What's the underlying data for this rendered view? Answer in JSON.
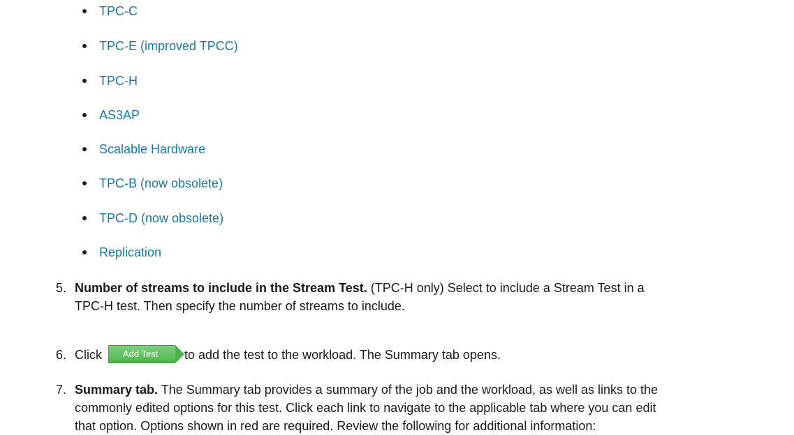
{
  "bullets": [
    "TPC-C",
    "TPC-E (improved TPCC)",
    "TPC-H",
    "AS3AP",
    "Scalable Hardware",
    "TPC-B (now obsolete)",
    "TPC-D (now obsolete)",
    "Replication"
  ],
  "steps": {
    "s5": {
      "num": "5.",
      "bold": "Number of streams to include in the Stream Test.",
      "text_l1": " (TPC-H only) Select to include a Stream Test in a",
      "text_l2": "TPC-H test. Then specify the number of streams to include."
    },
    "s6": {
      "num": "6.",
      "pre": "Click",
      "button": "Add Test",
      "post": "to add the test to the workload. The Summary tab opens."
    },
    "s7": {
      "num": "7.",
      "bold": "Summary tab.",
      "text_l1": " The Summary tab provides a summary of the job and the workload, as well as links to the",
      "text_l2": "commonly edited options for this test. Click each link to navigate to the applicable tab where you can edit",
      "text_l3": "that option. Options shown in red are required. Review the following for additional information:"
    }
  }
}
